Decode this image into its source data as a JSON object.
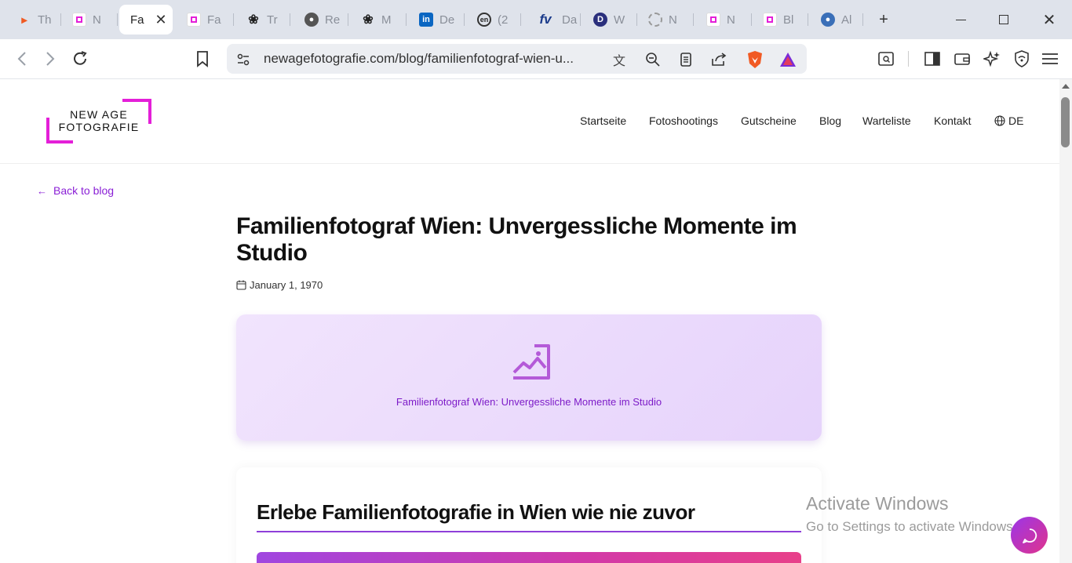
{
  "tabs": [
    {
      "label": "Th",
      "icon": "orange-app-icon"
    },
    {
      "label": "N",
      "icon": "new-age-favicon"
    },
    {
      "label": "Fa",
      "icon": "blank",
      "active": true
    },
    {
      "label": "Fa",
      "icon": "new-age-favicon"
    },
    {
      "label": "Tr",
      "icon": "chatgpt-icon"
    },
    {
      "label": "Re",
      "icon": "globe-icon"
    },
    {
      "label": "M",
      "icon": "chatgpt-icon"
    },
    {
      "label": "De",
      "icon": "linkedin-icon"
    },
    {
      "label": "(2",
      "icon": "en-icon"
    },
    {
      "label": "Da",
      "icon": "fv-icon"
    },
    {
      "label": "W",
      "icon": "d-icon"
    },
    {
      "label": "N",
      "icon": "loading-icon"
    },
    {
      "label": "N",
      "icon": "new-age-favicon"
    },
    {
      "label": "Bl",
      "icon": "new-age-favicon"
    },
    {
      "label": "Al",
      "icon": "brain-icon"
    }
  ],
  "browser": {
    "url": "newagefotografie.com/blog/familienfotograf-wien-u..."
  },
  "site": {
    "logo_line1": "NEW AGE",
    "logo_line2": "FOTOGRAFIE",
    "nav": [
      "Startseite",
      "Fotoshootings",
      "Gutscheine",
      "Blog",
      "Warteliste",
      "Kontakt"
    ],
    "lang": "DE"
  },
  "article": {
    "back_label": "Back to blog",
    "title": "Familienfotograf Wien: Unvergessliche Momente im Studio",
    "date": "January 1, 1970",
    "hero_caption": "Familienfotograf Wien: Unvergessliche Momente im Studio",
    "section_heading": "Erlebe Familienfotografie in Wien wie nie zuvor"
  },
  "watermark": {
    "line1": "Activate Windows",
    "line2": "Go to Settings to activate Windows."
  },
  "colors": {
    "accent": "#8a1fd6",
    "logo_magenta": "#e41fd8"
  }
}
